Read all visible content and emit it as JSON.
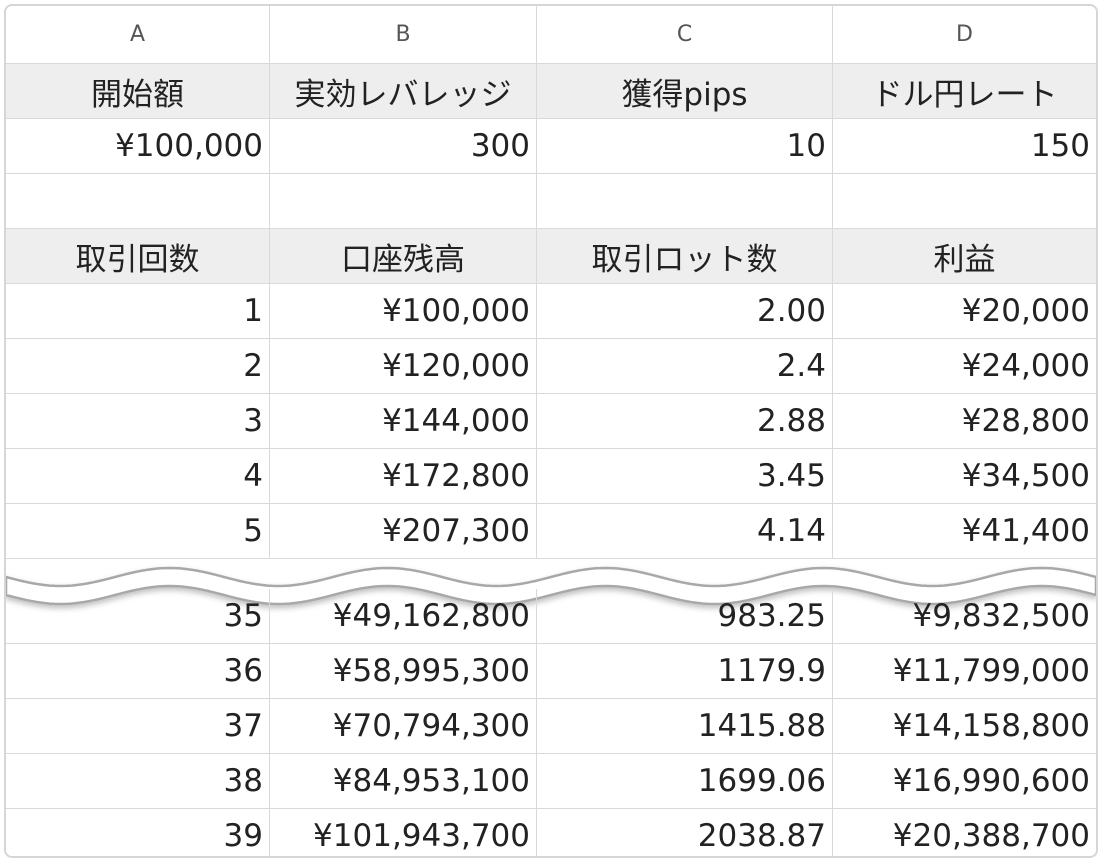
{
  "columns": [
    "A",
    "B",
    "C",
    "D"
  ],
  "params": {
    "labels": [
      "開始額",
      "実効レバレッジ",
      "獲得pips",
      "ドル円レート"
    ],
    "values": [
      "¥100,000",
      "300",
      "10",
      "150"
    ]
  },
  "table": {
    "headers": [
      "取引回数",
      "口座残高",
      "取引ロット数",
      "利益"
    ],
    "rows_top": [
      [
        "1",
        "¥100,000",
        "2.00",
        "¥20,000"
      ],
      [
        "2",
        "¥120,000",
        "2.4",
        "¥24,000"
      ],
      [
        "3",
        "¥144,000",
        "2.88",
        "¥28,800"
      ],
      [
        "4",
        "¥172,800",
        "3.45",
        "¥34,500"
      ],
      [
        "5",
        "¥207,300",
        "4.14",
        "¥41,400"
      ]
    ],
    "rows_bottom": [
      [
        "35",
        "¥49,162,800",
        "983.25",
        "¥9,832,500"
      ],
      [
        "36",
        "¥58,995,300",
        "1179.9",
        "¥11,799,000"
      ],
      [
        "37",
        "¥70,794,300",
        "1415.88",
        "¥14,158,800"
      ],
      [
        "38",
        "¥84,953,100",
        "1699.06",
        "¥16,990,600"
      ],
      [
        "39",
        "¥101,943,700",
        "2038.87",
        "¥20,388,700"
      ]
    ]
  }
}
